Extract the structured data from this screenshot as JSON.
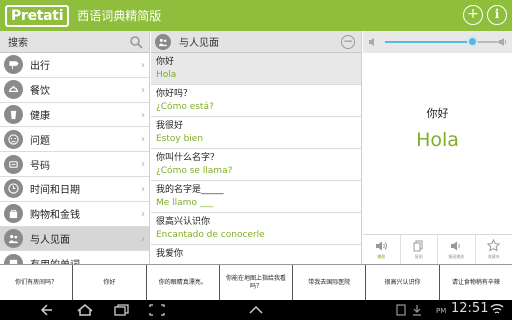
{
  "header": {
    "logo": "Pretati",
    "title": "西语词典精简版",
    "plus_glyph": "+",
    "info_glyph": "i"
  },
  "sidebar": {
    "search_label": "搜索",
    "items": [
      {
        "label": "出行",
        "icon": "signpost-icon"
      },
      {
        "label": "餐饮",
        "icon": "dish-icon"
      },
      {
        "label": "健康",
        "icon": "cup-icon"
      },
      {
        "label": "问题",
        "icon": "sad-face-icon"
      },
      {
        "label": "号码",
        "icon": "number-icon"
      },
      {
        "label": "时间和日期",
        "icon": "clock-icon"
      },
      {
        "label": "购物和金钱",
        "icon": "shopping-bag-icon"
      },
      {
        "label": "与人见面",
        "icon": "people-icon"
      },
      {
        "label": "有用的单词",
        "icon": "book-icon"
      }
    ]
  },
  "phrases_panel": {
    "title": "与人见面",
    "items": [
      {
        "zh": "你好",
        "es": "Hola"
      },
      {
        "zh": "你好吗？",
        "es": "¿Cómo está?"
      },
      {
        "zh": "我很好",
        "es": "Estoy bien"
      },
      {
        "zh": "你叫什么名字？",
        "es": "¿Cómo se llama?"
      },
      {
        "zh": "我的名字是_____",
        "es": "Me llamo ___"
      },
      {
        "zh": "很高兴认识你",
        "es": "Encantado de conocerle"
      },
      {
        "zh": "我爱你",
        "es": ""
      }
    ]
  },
  "detail": {
    "zh": "你好",
    "es": "Hola",
    "actions": [
      {
        "label": "播放",
        "icon": "speaker-icon"
      },
      {
        "label": "复制",
        "icon": "copy-icon"
      },
      {
        "label": "慢速播放",
        "icon": "slow-speaker-icon"
      },
      {
        "label": "收藏夹",
        "icon": "star-icon"
      }
    ]
  },
  "suggestions": [
    "你们有房间吗？",
    "你好",
    "你的眼睛真漂亮。",
    "你能在地图上指给我看吗？",
    "带我去国际医院",
    "很高兴认识你",
    "请让食物稍有辛辣"
  ],
  "status": {
    "ampm": "PM",
    "time": "12:51"
  },
  "colors": {
    "accent": "#8fbd3c",
    "spanish_text": "#7fae28",
    "volume": "#5bb6e0"
  }
}
